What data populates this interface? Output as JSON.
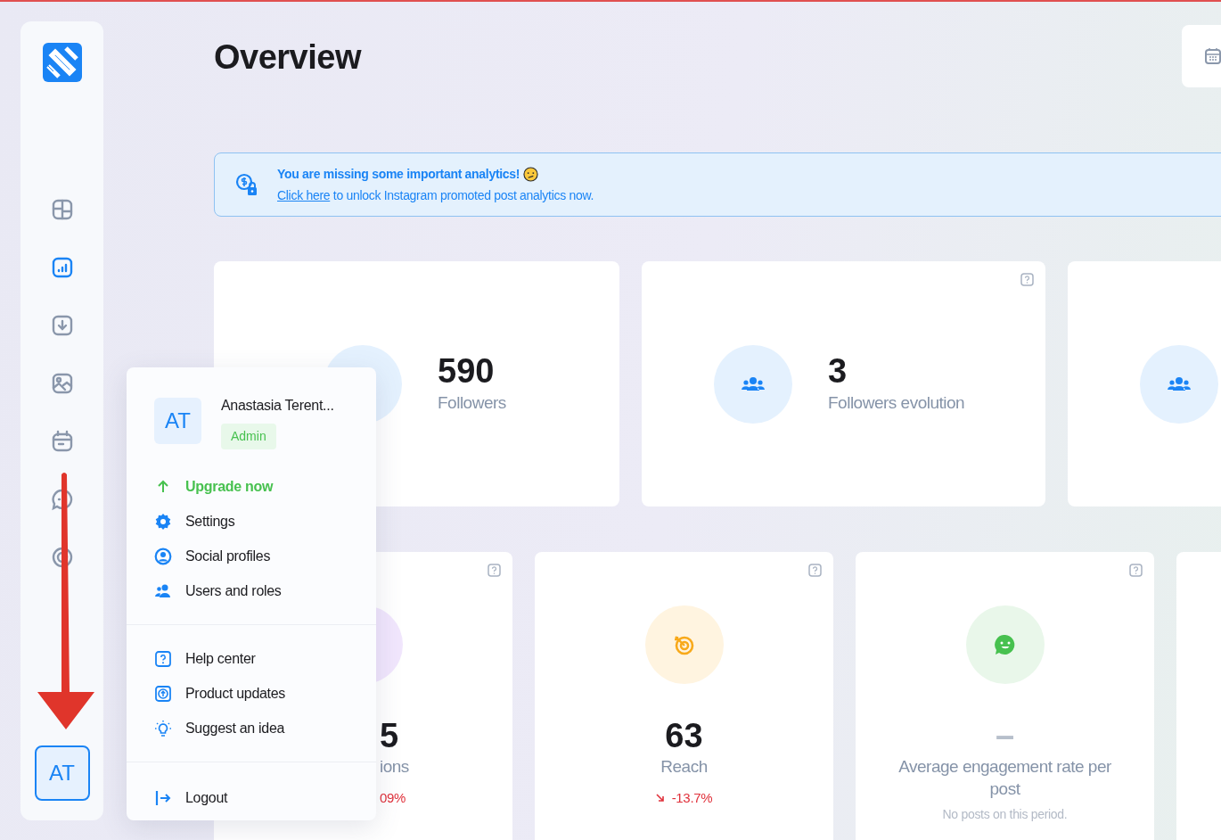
{
  "sidebar": {
    "items": [
      {
        "selected": false
      },
      {
        "selected": true
      },
      {
        "selected": false
      },
      {
        "selected": false
      },
      {
        "selected": false
      },
      {
        "selected": false
      },
      {
        "selected": false
      }
    ],
    "avatar": "AT"
  },
  "header": {
    "title": "Overview"
  },
  "banner": {
    "title": "You are missing some important analytics!",
    "link": "Click here",
    "text": "to unlock Instagram promoted post analytics now."
  },
  "top_cards": [
    {
      "kind": "followers",
      "value": "590",
      "label": "Followers",
      "help": false,
      "icon_covered": true
    },
    {
      "kind": "followers",
      "value": "3",
      "label": "Followers evolution",
      "help": true
    },
    {
      "kind": "followers",
      "help": false
    }
  ],
  "bottom_cards": [
    {
      "kind": "impressions",
      "value": "5",
      "label": "ions",
      "change": "09%",
      "falling": true,
      "help": true,
      "icon_covered": true
    },
    {
      "kind": "reach",
      "value": "63",
      "label": "Reach",
      "change": "-13.7%",
      "falling": true,
      "help": true
    },
    {
      "kind": "engagement",
      "value": "–",
      "label": "Average engagement rate per post",
      "note": "No posts on this period.",
      "help": true
    },
    {
      "kind": "blank",
      "help": false
    }
  ],
  "user_menu": {
    "initials": "AT",
    "name": "Anastasia Terent...",
    "role": "Admin",
    "groups": [
      [
        {
          "kind": "upgrade",
          "label": "Upgrade now"
        },
        {
          "kind": "settings",
          "label": "Settings"
        },
        {
          "kind": "profile",
          "label": "Social profiles"
        },
        {
          "kind": "users",
          "label": "Users and roles"
        }
      ],
      [
        {
          "kind": "help",
          "label": "Help center"
        },
        {
          "kind": "updates",
          "label": "Product updates"
        },
        {
          "kind": "idea",
          "label": "Suggest an idea"
        }
      ],
      [
        {
          "kind": "logout",
          "label": "Logout"
        }
      ]
    ]
  }
}
